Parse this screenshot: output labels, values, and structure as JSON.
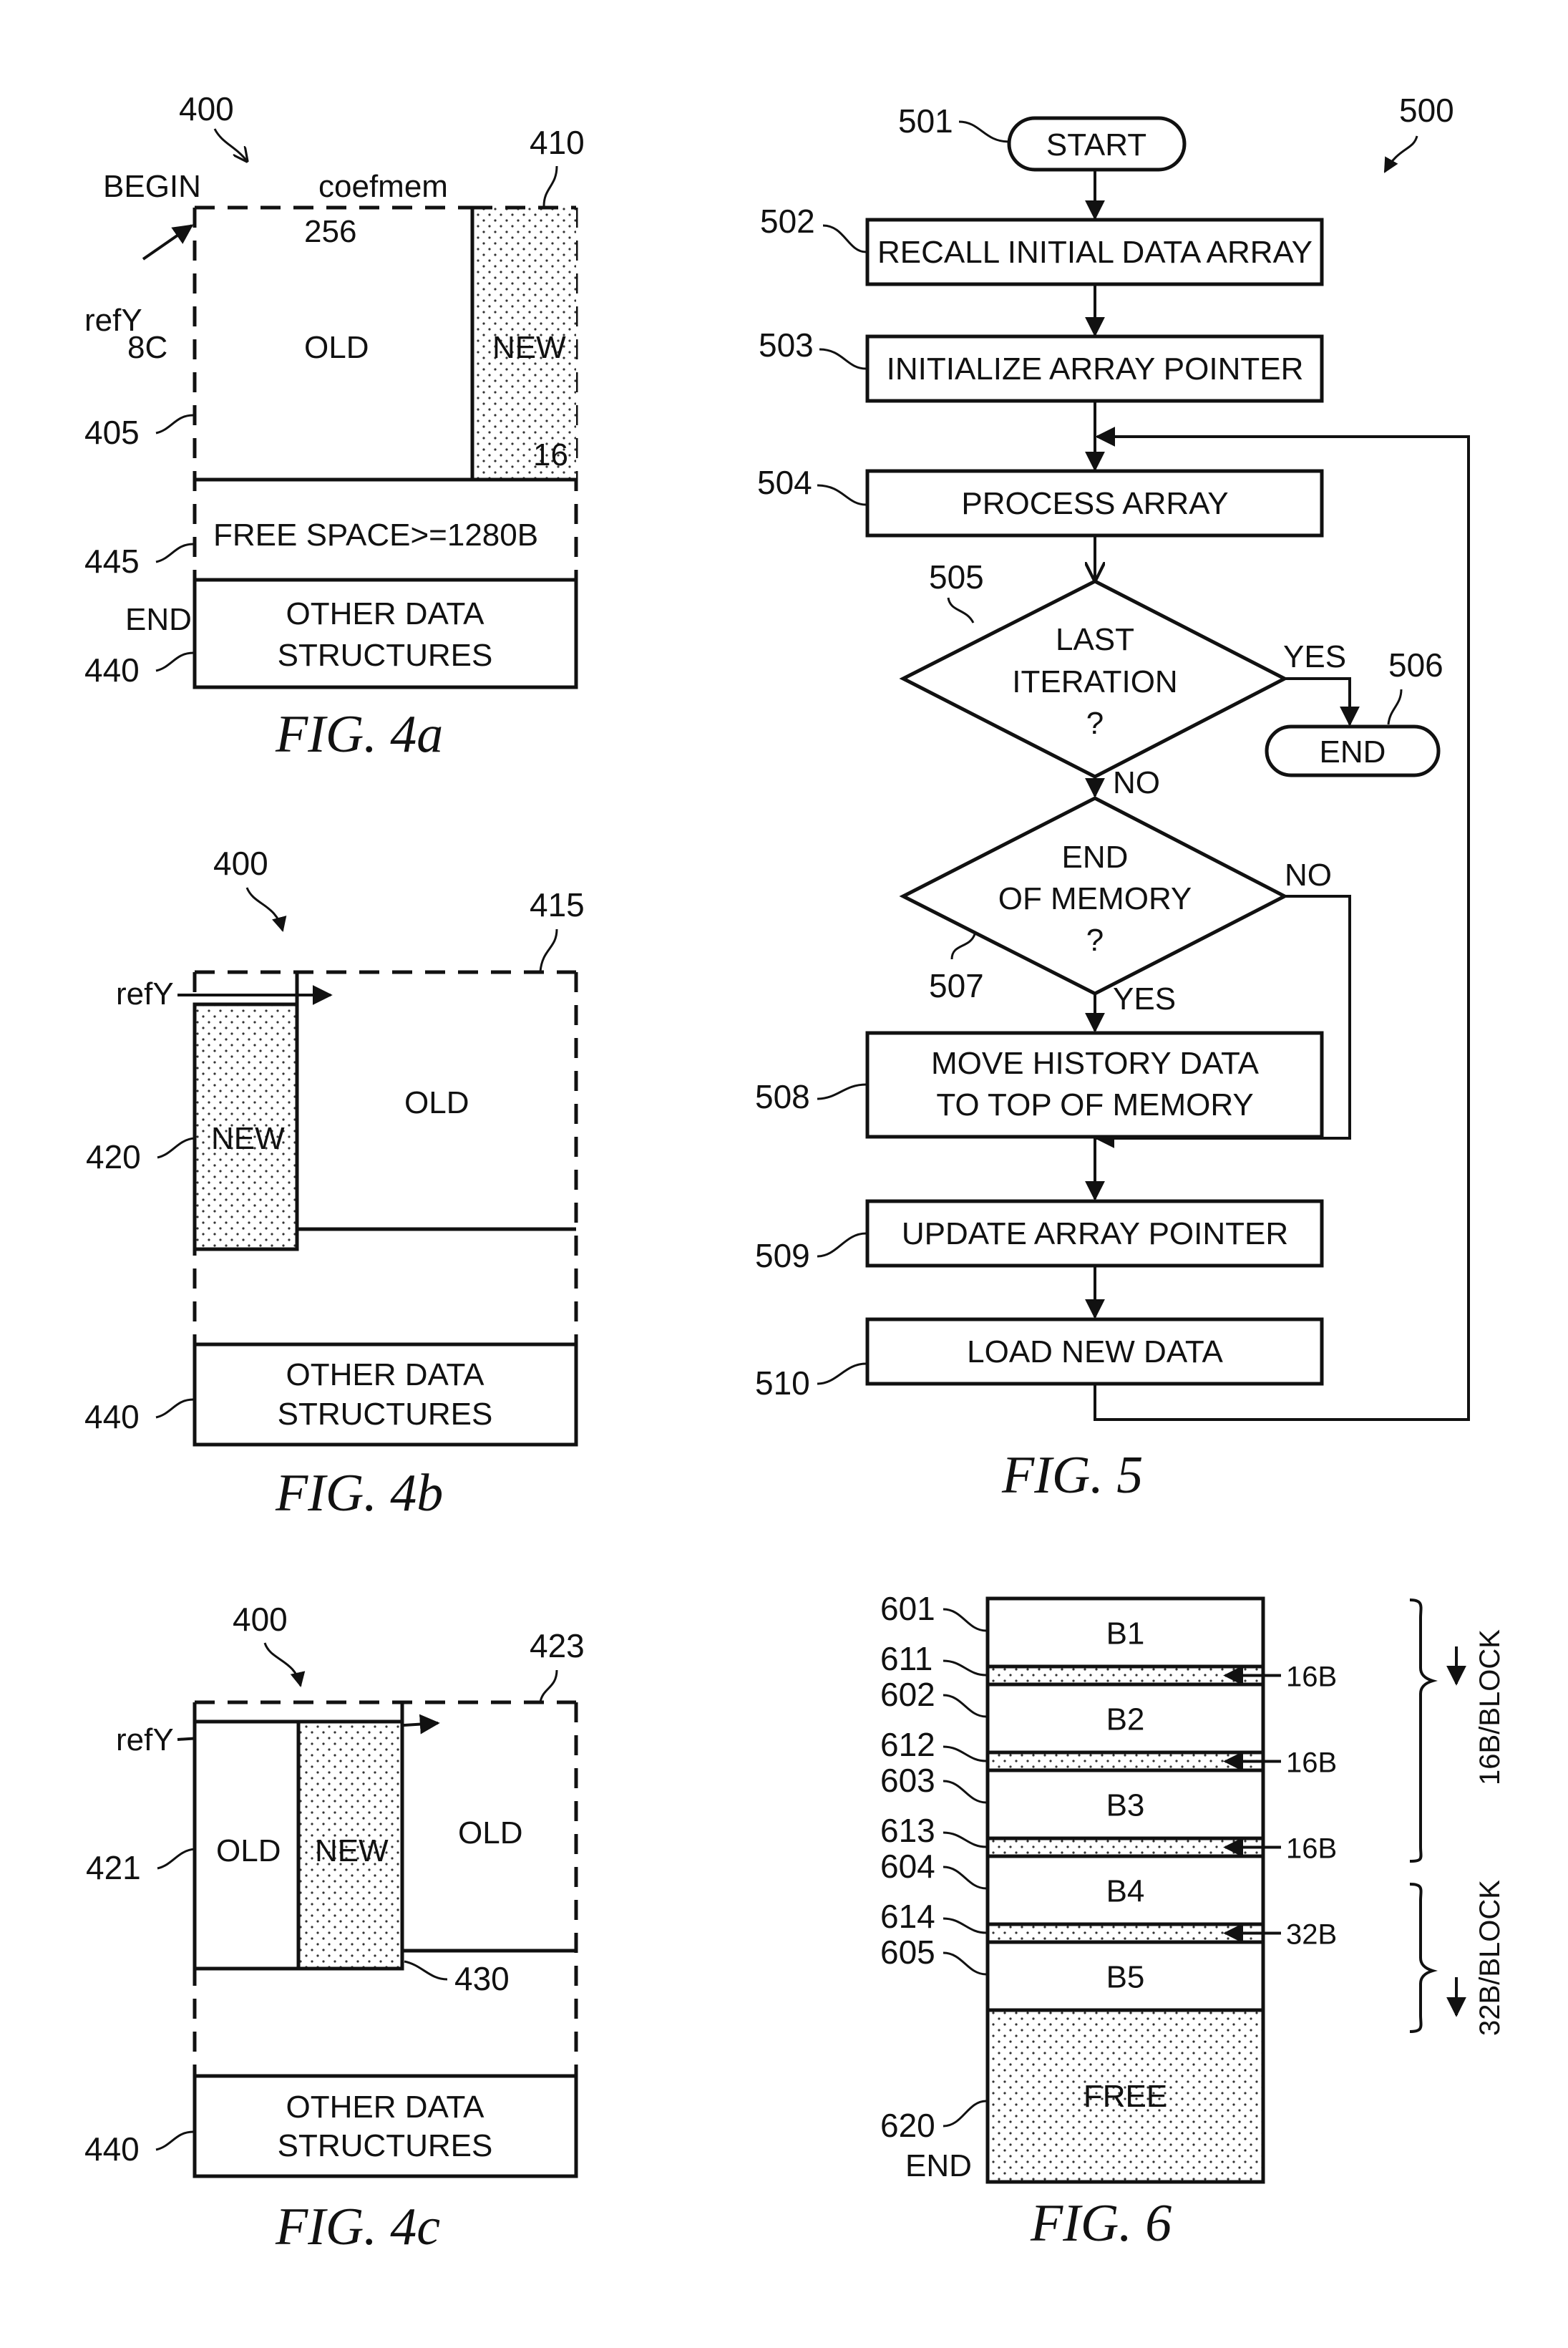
{
  "fig4a": {
    "ref": "400",
    "ref_region": "410",
    "begin": "BEGIN",
    "coefmem": "coefmem",
    "refy": "refY",
    "width_label": "256",
    "height_label": "8C",
    "old": "OLD",
    "new": "NEW",
    "new_width": "16",
    "ref_old": "405",
    "free_space": "FREE SPACE>=1280B",
    "ref_free": "445",
    "end": "END",
    "other_1": "OTHER DATA",
    "other_2": "STRUCTURES",
    "ref_other": "440",
    "caption": "FIG. 4a"
  },
  "fig4b": {
    "ref": "400",
    "ref_region": "415",
    "refy": "refY",
    "new": "NEW",
    "old": "OLD",
    "ref_new": "420",
    "other_1": "OTHER DATA",
    "other_2": "STRUCTURES",
    "ref_other": "440",
    "caption": "FIG. 4b"
  },
  "fig4c": {
    "ref": "400",
    "ref_region": "423",
    "refy": "refY",
    "old_left": "OLD",
    "new": "NEW",
    "old_right": "OLD",
    "ref_left": "421",
    "ref_new_bottom": "430",
    "other_1": "OTHER DATA",
    "other_2": "STRUCTURES",
    "ref_other": "440",
    "caption": "FIG. 4c"
  },
  "fig5": {
    "ref": "500",
    "start": {
      "ref": "501",
      "label": "START"
    },
    "steps": [
      {
        "ref": "502",
        "label": "RECALL INITIAL DATA ARRAY"
      },
      {
        "ref": "503",
        "label": "INITIALIZE ARRAY POINTER"
      },
      {
        "ref": "504",
        "label": "PROCESS ARRAY"
      }
    ],
    "decision1": {
      "ref": "505",
      "line1": "LAST",
      "line2": "ITERATION",
      "line3": "?",
      "yes": "YES",
      "no": "NO"
    },
    "end": {
      "ref": "506",
      "label": "END"
    },
    "decision2": {
      "ref": "507",
      "line1": "END",
      "line2": "OF MEMORY",
      "line3": "?",
      "yes": "YES",
      "no": "NO"
    },
    "move": {
      "ref": "508",
      "line1": "MOVE HISTORY DATA",
      "line2": "TO TOP OF MEMORY"
    },
    "update": {
      "ref": "509",
      "label": "UPDATE ARRAY POINTER"
    },
    "load": {
      "ref": "510",
      "label": "LOAD NEW DATA"
    },
    "caption": "FIG. 5"
  },
  "fig6": {
    "blocks": [
      {
        "ref": "601",
        "label": "B1"
      },
      {
        "ref": "602",
        "label": "B2"
      },
      {
        "ref": "603",
        "label": "B3"
      },
      {
        "ref": "604",
        "label": "B4"
      },
      {
        "ref": "605",
        "label": "B5"
      }
    ],
    "gaps": [
      {
        "ref": "611",
        "size": "16B"
      },
      {
        "ref": "612",
        "size": "16B"
      },
      {
        "ref": "613",
        "size": "16B"
      },
      {
        "ref": "614",
        "size": "32B"
      }
    ],
    "free": {
      "ref": "620",
      "label": "FREE",
      "end": "END"
    },
    "brace1": "16B/BLOCK",
    "brace2": "32B/BLOCK",
    "caption": "FIG. 6"
  }
}
